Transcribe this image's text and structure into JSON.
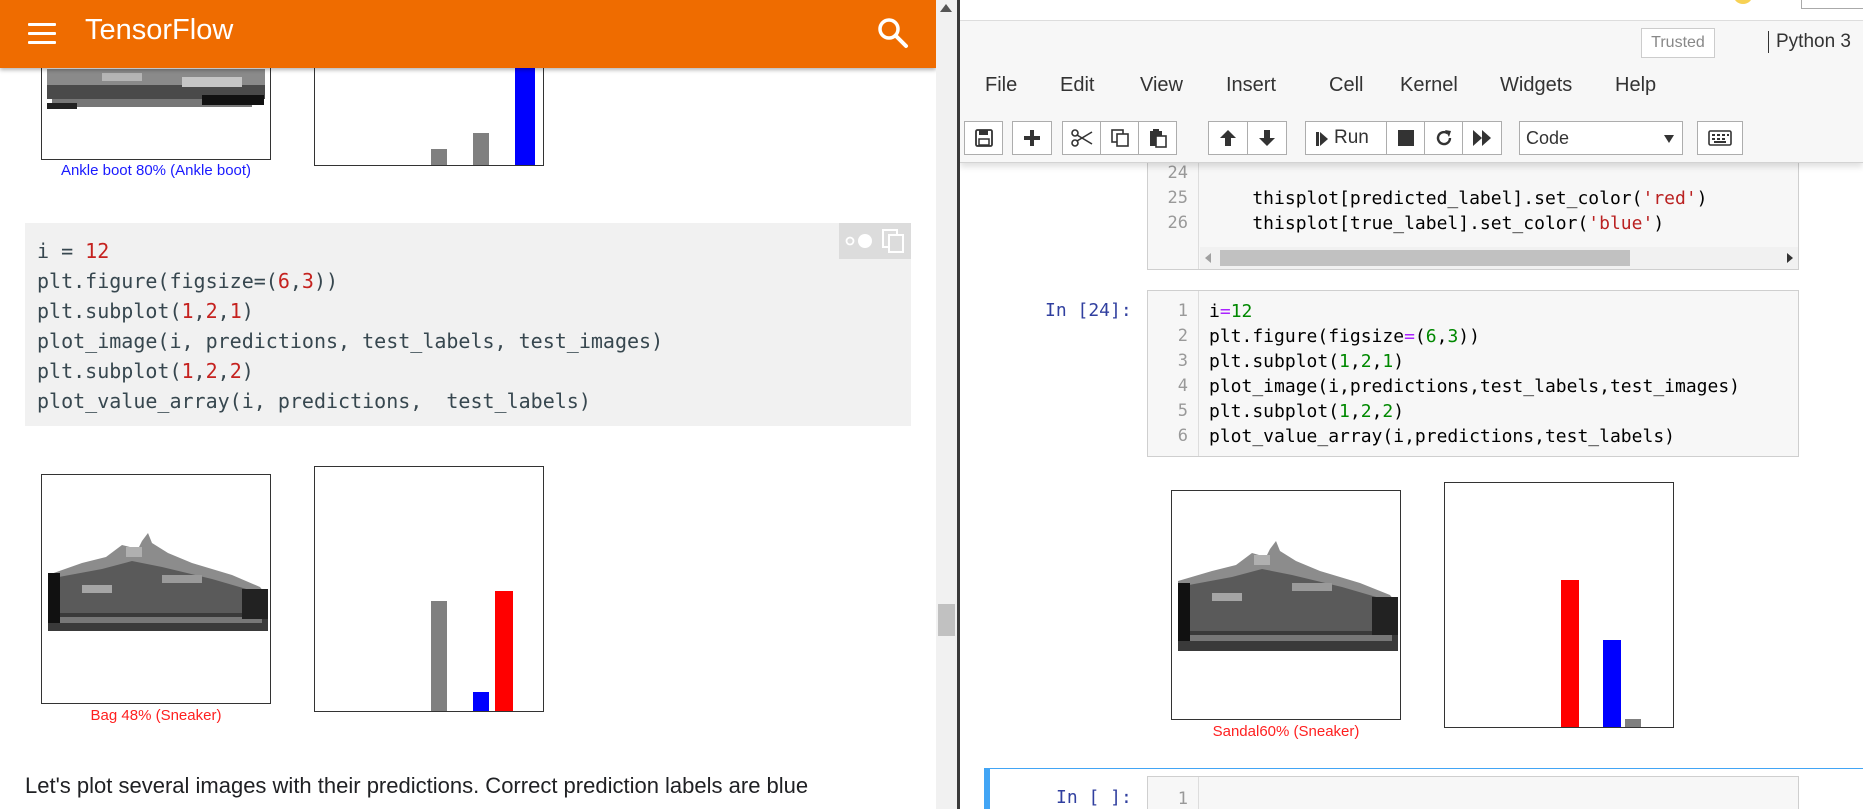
{
  "left": {
    "header": {
      "title": "TensorFlow",
      "menu_icon": "hamburger-menu-icon",
      "search_icon": "search-icon"
    },
    "top_plot": {
      "caption": "Ankle boot 80% (Ankle boot)",
      "caption_color": "#1a1aff"
    },
    "code": {
      "lines": [
        [
          {
            "t": "i = "
          },
          {
            "t": "12",
            "c": "num"
          }
        ],
        [
          {
            "t": "plt.figure(figsize=("
          },
          {
            "t": "6",
            "c": "num"
          },
          {
            "t": ","
          },
          {
            "t": "3",
            "c": "num"
          },
          {
            "t": "))"
          }
        ],
        [
          {
            "t": "plt.subplot("
          },
          {
            "t": "1",
            "c": "num"
          },
          {
            "t": ","
          },
          {
            "t": "2",
            "c": "num"
          },
          {
            "t": ","
          },
          {
            "t": "1",
            "c": "num"
          },
          {
            "t": ")"
          }
        ],
        [
          {
            "t": "plot_image(i, predictions, test_labels, test_images)"
          }
        ],
        [
          {
            "t": "plt.subplot("
          },
          {
            "t": "1",
            "c": "num"
          },
          {
            "t": ","
          },
          {
            "t": "2",
            "c": "num"
          },
          {
            "t": ","
          },
          {
            "t": "2",
            "c": "num"
          },
          {
            "t": ")"
          }
        ],
        [
          {
            "t": "plot_value_array(i, predictions,  test_labels)"
          }
        ]
      ],
      "tools_icons": [
        "dark-mode-toggle-icon",
        "copy-icon"
      ]
    },
    "bottom_plot": {
      "caption": "Bag 48% (Sneaker)",
      "caption_color": "#ff2020"
    },
    "paragraph": "Let's plot several images with their predictions. Correct prediction labels are blue"
  },
  "right": {
    "trusted": "Trusted",
    "kernel": "Python 3",
    "menu": [
      "File",
      "Edit",
      "View",
      "Insert",
      "Cell",
      "Kernel",
      "Widgets",
      "Help"
    ],
    "toolbar": {
      "icons": [
        "save-icon",
        "add-cell-icon",
        "cut-icon",
        "copy-icon",
        "paste-icon",
        "move-up-icon",
        "move-down-icon",
        "run-icon",
        "stop-icon",
        "restart-icon",
        "fast-forward-icon",
        "keyboard-icon"
      ],
      "run_label": "Run",
      "cell_type": "Code"
    },
    "prev_cell": {
      "line_numbers": [
        "24",
        "25",
        "26"
      ],
      "lines": [
        [
          {
            "t": ""
          }
        ],
        [
          {
            "t": "    thisplot[predicted_label].set_color("
          },
          {
            "t": "'red'",
            "c": "str"
          },
          {
            "t": ")"
          }
        ],
        [
          {
            "t": "    thisplot[true_label].set_color("
          },
          {
            "t": "'blue'",
            "c": "str"
          },
          {
            "t": ")"
          }
        ]
      ]
    },
    "cell24": {
      "prompt": "In [24]:",
      "line_numbers": [
        "1",
        "2",
        "3",
        "4",
        "5",
        "6"
      ],
      "lines": [
        [
          {
            "t": "i"
          },
          {
            "t": "=",
            "c": "op"
          },
          {
            "t": "12",
            "c": "jnum"
          }
        ],
        [
          {
            "t": "plt.figure(figsize"
          },
          {
            "t": "=",
            "c": "op"
          },
          {
            "t": "("
          },
          {
            "t": "6",
            "c": "jnum"
          },
          {
            "t": ","
          },
          {
            "t": "3",
            "c": "jnum"
          },
          {
            "t": "))"
          }
        ],
        [
          {
            "t": "plt.subplot("
          },
          {
            "t": "1",
            "c": "jnum"
          },
          {
            "t": ","
          },
          {
            "t": "2",
            "c": "jnum"
          },
          {
            "t": ","
          },
          {
            "t": "1",
            "c": "jnum"
          },
          {
            "t": ")"
          }
        ],
        [
          {
            "t": "plot_image(i,predictions,test_labels,test_images)"
          }
        ],
        [
          {
            "t": "plt.subplot("
          },
          {
            "t": "1",
            "c": "jnum"
          },
          {
            "t": ","
          },
          {
            "t": "2",
            "c": "jnum"
          },
          {
            "t": ","
          },
          {
            "t": "2",
            "c": "jnum"
          },
          {
            "t": ")"
          }
        ],
        [
          {
            "t": "plot_value_array(i,predictions,test_labels)"
          }
        ]
      ]
    },
    "output_plot": {
      "caption": "Sandal60% (Sneaker)",
      "caption_color": "#ff2020"
    },
    "empty_cell": {
      "prompt": "In [ ]:",
      "line_number": "1"
    }
  },
  "colors": {
    "tf_orange": "#ef6c00",
    "bar_gray": "#808080",
    "bar_red": "#ff0000",
    "bar_blue": "#0000ff"
  }
}
